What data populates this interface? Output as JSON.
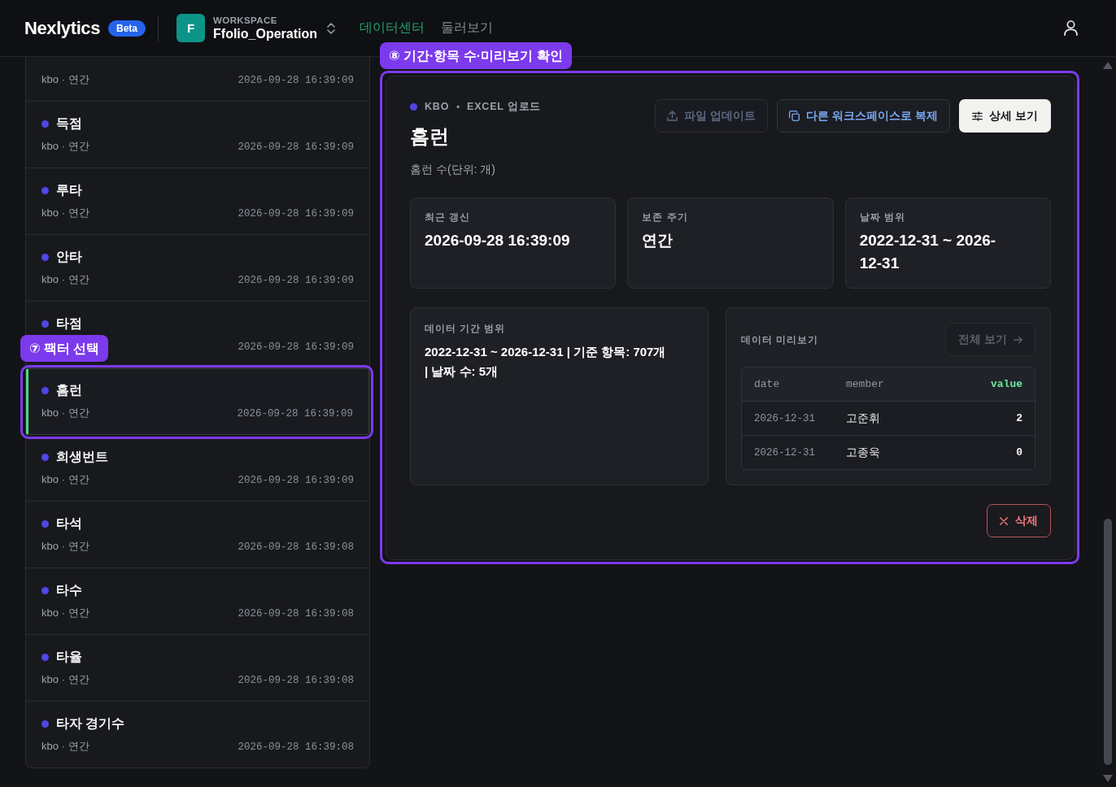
{
  "header": {
    "logo": "Nexlytics",
    "badge": "Beta",
    "workspace": {
      "avatar": "F",
      "caption": "WORKSPACE",
      "name": "Ffolio_Operation"
    },
    "nav": [
      {
        "label": "데이터센터",
        "selected": true
      },
      {
        "label": "둘러보기",
        "selected": false
      }
    ]
  },
  "factor_list": {
    "annotation": {
      "label": "⑦ 팩터 선택"
    },
    "items": [
      {
        "meta": "kbo · 연간",
        "time": "2026-09-28 16:39:09",
        "selected": false
      },
      {
        "name": "득점",
        "meta": "kbo · 연간",
        "time": "2026-09-28 16:39:09",
        "selected": false
      },
      {
        "name": "루타",
        "meta": "kbo · 연간",
        "time": "2026-09-28 16:39:09",
        "selected": false
      },
      {
        "name": "안타",
        "meta": "kbo · 연간",
        "time": "2026-09-28 16:39:09",
        "selected": false
      },
      {
        "name": "타점",
        "time": "2026-09-28 16:39:09",
        "selected": false
      },
      {
        "name": "홈런",
        "meta": "kbo · 연간",
        "time": "2026-09-28 16:39:09",
        "selected": true
      },
      {
        "name": "희생번트",
        "meta": "kbo · 연간",
        "time": "2026-09-28 16:39:09",
        "selected": false
      },
      {
        "name": "타석",
        "meta": "kbo · 연간",
        "time": "2026-09-28 16:39:08",
        "selected": false
      },
      {
        "name": "타수",
        "meta": "kbo · 연간",
        "time": "2026-09-28 16:39:08",
        "selected": false
      },
      {
        "name": "타율",
        "meta": "kbo · 연간",
        "time": "2026-09-28 16:39:08",
        "selected": false
      },
      {
        "name": "타자 경기수",
        "meta": "kbo · 연간",
        "time": "2026-09-28 16:39:08",
        "selected": false
      }
    ]
  },
  "detail": {
    "annotation": {
      "label": "⑧ 기간·항목 수·미리보기 확인"
    },
    "source": {
      "provider": "KBO",
      "separator": "•",
      "type": "EXCEL 업로드"
    },
    "title": "홈런",
    "description": "홈런 수(단위: 개)",
    "actions": [
      {
        "label": "파일 업데이트",
        "kind": "upload",
        "disabled": true
      },
      {
        "label": "다른 워크스페이스로 복제",
        "kind": "copy",
        "disabled": false
      },
      {
        "label": "상세 보기",
        "kind": "details",
        "disabled": false
      }
    ],
    "stats": [
      {
        "label": "최근 갱신",
        "value": "2026-09-28 16:39:09"
      },
      {
        "label": "보존 주기",
        "value": "연간"
      },
      {
        "label": "날짜 범위",
        "value": "2022-12-31 ~ 2026-12-31"
      }
    ],
    "range": {
      "label": "데이터 기간 범위",
      "value": "2022-12-31 ~ 2026-12-31 | 기준 항목: 707개 | 날짜 수: 5개"
    },
    "preview": {
      "label": "데이터 미리보기",
      "view_all": {
        "label": "전체 보기",
        "disabled": true
      },
      "columns": [
        {
          "label": "date",
          "highlighted": false
        },
        {
          "label": "member",
          "highlighted": false
        },
        {
          "label": "value",
          "highlighted": true
        }
      ],
      "rows": [
        [
          "2026-12-31",
          "고준휘",
          "2"
        ],
        [
          "2026-12-31",
          "고종욱",
          "0"
        ]
      ]
    },
    "delete": {
      "label": "삭제"
    }
  }
}
